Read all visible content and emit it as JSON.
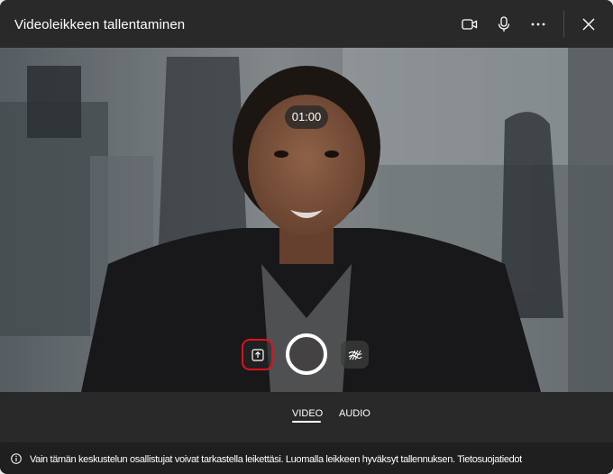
{
  "header": {
    "title": "Videoleikkeen tallentaminen",
    "icons": [
      "video-camera-icon",
      "microphone-icon",
      "more-options-icon",
      "close-icon"
    ]
  },
  "preview": {
    "timer": "01:00",
    "controls": [
      "upload-icon",
      "record-button",
      "background-effects-icon"
    ]
  },
  "modes": {
    "tabs": [
      {
        "label": "VIDEO",
        "selected": true
      },
      {
        "label": "AUDIO",
        "selected": false
      }
    ]
  },
  "footer": {
    "notice": "Vain tämän keskustelun osallistujat voivat tarkastella leikettäsi. Luomalla leikkeen hyväksyt tallennuksen.",
    "link": "Tietosuojatiedot"
  },
  "colors": {
    "dialog_bg": "#292929",
    "footer_bg": "#1f1f1f",
    "highlight": "#e0101a"
  }
}
